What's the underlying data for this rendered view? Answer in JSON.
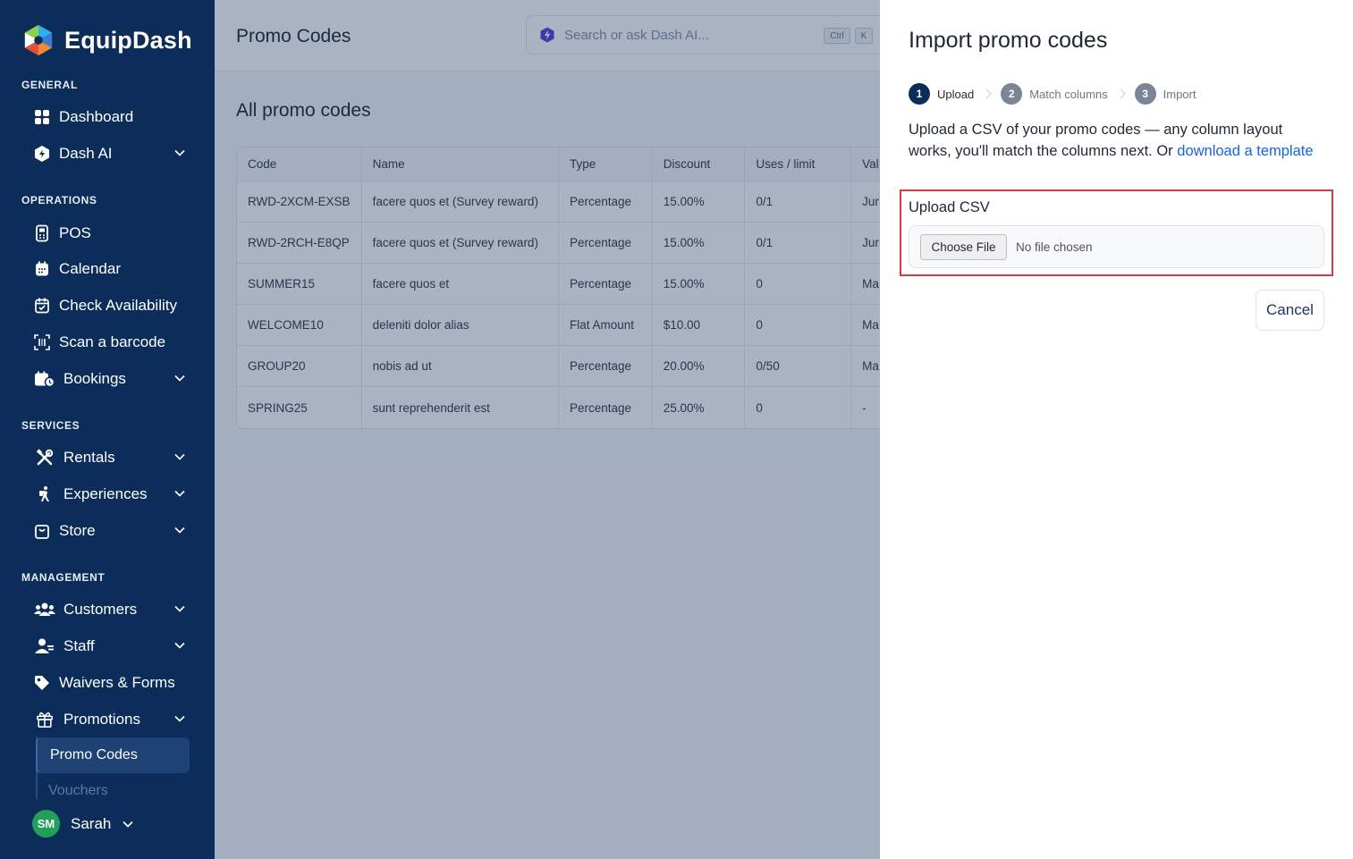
{
  "brand": {
    "name": "EquipDash"
  },
  "sidebar": {
    "sections": {
      "general": "GENERAL",
      "operations": "OPERATIONS",
      "services": "SERVICES",
      "management": "MANAGEMENT"
    },
    "items": {
      "dashboard": "Dashboard",
      "dash_ai": "Dash AI",
      "pos": "POS",
      "calendar": "Calendar",
      "check_availability": "Check Availability",
      "scan_barcode": "Scan a barcode",
      "bookings": "Bookings",
      "rentals": "Rentals",
      "experiences": "Experiences",
      "store": "Store",
      "customers": "Customers",
      "staff": "Staff",
      "waivers_forms": "Waivers & Forms",
      "promotions": "Promotions"
    },
    "sub_items": {
      "promo_codes": "Promo Codes",
      "vouchers": "Vouchers"
    },
    "user": {
      "initials": "SM",
      "name": "Sarah"
    }
  },
  "header": {
    "title": "Promo Codes",
    "search_placeholder": "Search or ask Dash AI...",
    "shortcut_ctrl": "Ctrl",
    "shortcut_key": "K"
  },
  "main": {
    "section_title": "All promo codes",
    "table": {
      "columns": [
        "Code",
        "Name",
        "Type",
        "Discount",
        "Uses / limit",
        "Val"
      ],
      "rows": [
        [
          "RWD-2XCM-EXSB",
          "facere quos et (Survey reward)",
          "Percentage",
          "15.00%",
          "0/1",
          "Jur"
        ],
        [
          "RWD-2RCH-E8QP",
          "facere quos et (Survey reward)",
          "Percentage",
          "15.00%",
          "0/1",
          "Jur"
        ],
        [
          "SUMMER15",
          "facere quos et",
          "Percentage",
          "15.00%",
          "0",
          "Ma"
        ],
        [
          "WELCOME10",
          "deleniti dolor alias",
          "Flat Amount",
          "$10.00",
          "0",
          "Ma"
        ],
        [
          "GROUP20",
          "nobis ad ut",
          "Percentage",
          "20.00%",
          "0/50",
          "Ma"
        ],
        [
          "SPRING25",
          "sunt reprehenderit est",
          "Percentage",
          "25.00%",
          "0",
          "-"
        ]
      ]
    }
  },
  "drawer": {
    "title": "Import promo codes",
    "steps": [
      {
        "num": "1",
        "label": "Upload"
      },
      {
        "num": "2",
        "label": "Match columns"
      },
      {
        "num": "3",
        "label": "Import"
      }
    ],
    "intro_text": "Upload a CSV of your promo codes — any column layout works, you'll match the columns next. Or ",
    "template_link": "download a template",
    "upload_label": "Upload CSV",
    "choose_file": "Choose File",
    "no_file": "No file chosen",
    "cancel": "Cancel"
  },
  "colors": {
    "sidebar_bg": "#0c2d59",
    "accent_link": "#1565d8",
    "highlight_border": "#d63a48",
    "avatar": "#22a05b"
  }
}
